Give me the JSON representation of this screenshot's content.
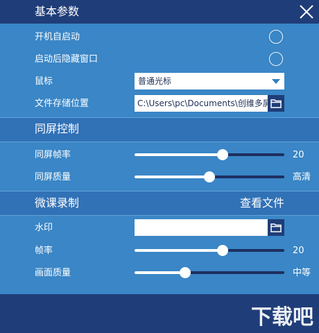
{
  "basic": {
    "title": "基本参数",
    "autostart_label": "开机自启动",
    "hide_window_label": "启动后隐藏窗口",
    "mouse_label": "鼠标",
    "mouse_value": "普通光标",
    "storage_label": "文件存储位置",
    "storage_path": "C:\\Users\\pc\\Documents\\创维多屏"
  },
  "screen_control": {
    "title": "同屏控制",
    "fps_label": "同屏帧率",
    "fps_value": "20",
    "fps_level": 0.59,
    "quality_label": "同屏质量",
    "quality_value": "高清",
    "quality_level": 0.5
  },
  "recording": {
    "title": "微课录制",
    "view_files_label": "查看文件",
    "watermark_label": "水印",
    "watermark_value": "",
    "fps_label": "帧率",
    "fps_value": "20",
    "fps_level": 0.59,
    "quality_label": "画面质量",
    "quality_value": "中等",
    "quality_level": 0.34
  },
  "logo_text": "下载吧",
  "colors": {
    "panel_bg": "#3a86c6",
    "header_bg": "#1f3d78",
    "band_bg": "#3171b6"
  }
}
